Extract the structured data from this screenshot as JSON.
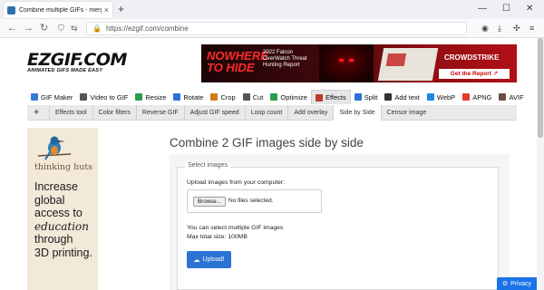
{
  "browser": {
    "tab_title": "Combine multiple GIFs - merge",
    "tab_close": "×",
    "new_tab": "+",
    "url": "https://ezgif.com/combine",
    "window_controls": [
      "—",
      "☐",
      "✕"
    ]
  },
  "logo": {
    "main": "EZGIF.COM",
    "tagline": "ANIMATED GIFS MADE EASY"
  },
  "top_ad": {
    "headline": "NOWHERE TO HIDE",
    "sub": "2022 Falcon OverWatch Threat Hunting Report",
    "brand": "CROWDSTRIKE",
    "cta": "Get the Report ↗"
  },
  "main_nav": [
    {
      "label": "GIF Maker",
      "color": "#3a7bd5"
    },
    {
      "label": "Video to GIF",
      "color": "#555555"
    },
    {
      "label": "Resize",
      "color": "#2a9d4b"
    },
    {
      "label": "Rotate",
      "color": "#2a73d4"
    },
    {
      "label": "Crop",
      "color": "#d07a1a"
    },
    {
      "label": "Cut",
      "color": "#555555"
    },
    {
      "label": "Optimize",
      "color": "#2a9d4b"
    },
    {
      "label": "Effects",
      "color": "#c0392b",
      "active": true
    },
    {
      "label": "Split",
      "color": "#2a73d4"
    },
    {
      "label": "Add text",
      "color": "#333333"
    },
    {
      "label": "WebP",
      "color": "#1e88e5"
    },
    {
      "label": "APNG",
      "color": "#e53935"
    },
    {
      "label": "AVIF",
      "color": "#6d4c41"
    }
  ],
  "sub_nav": [
    {
      "label": "Effects tool"
    },
    {
      "label": "Color filters"
    },
    {
      "label": "Reverse GIF"
    },
    {
      "label": "Adjust GIF speed"
    },
    {
      "label": "Loop count"
    },
    {
      "label": "Add overlay"
    },
    {
      "label": "Side by Side",
      "active": true
    },
    {
      "label": "Censor image"
    }
  ],
  "left_ad": {
    "brand": "thinking huts",
    "line1": "Increase",
    "line2": "global",
    "line3": "access to",
    "line4": "education",
    "line5": "through",
    "line6": "3D printing."
  },
  "main": {
    "title": "Combine 2 GIF images side by side",
    "legend": "Select images",
    "upload_label": "Upload images from your computer:",
    "browse_label": "Browse...",
    "no_file": "No files selected.",
    "info_multiple": "You can select multiple GIF images",
    "info_size": "Max total size: 100MB",
    "upload_button": "Upload!"
  },
  "privacy": "Privacy",
  "colors": {
    "accent": "#2a73d4",
    "privacy_bg": "#1a73e8"
  }
}
